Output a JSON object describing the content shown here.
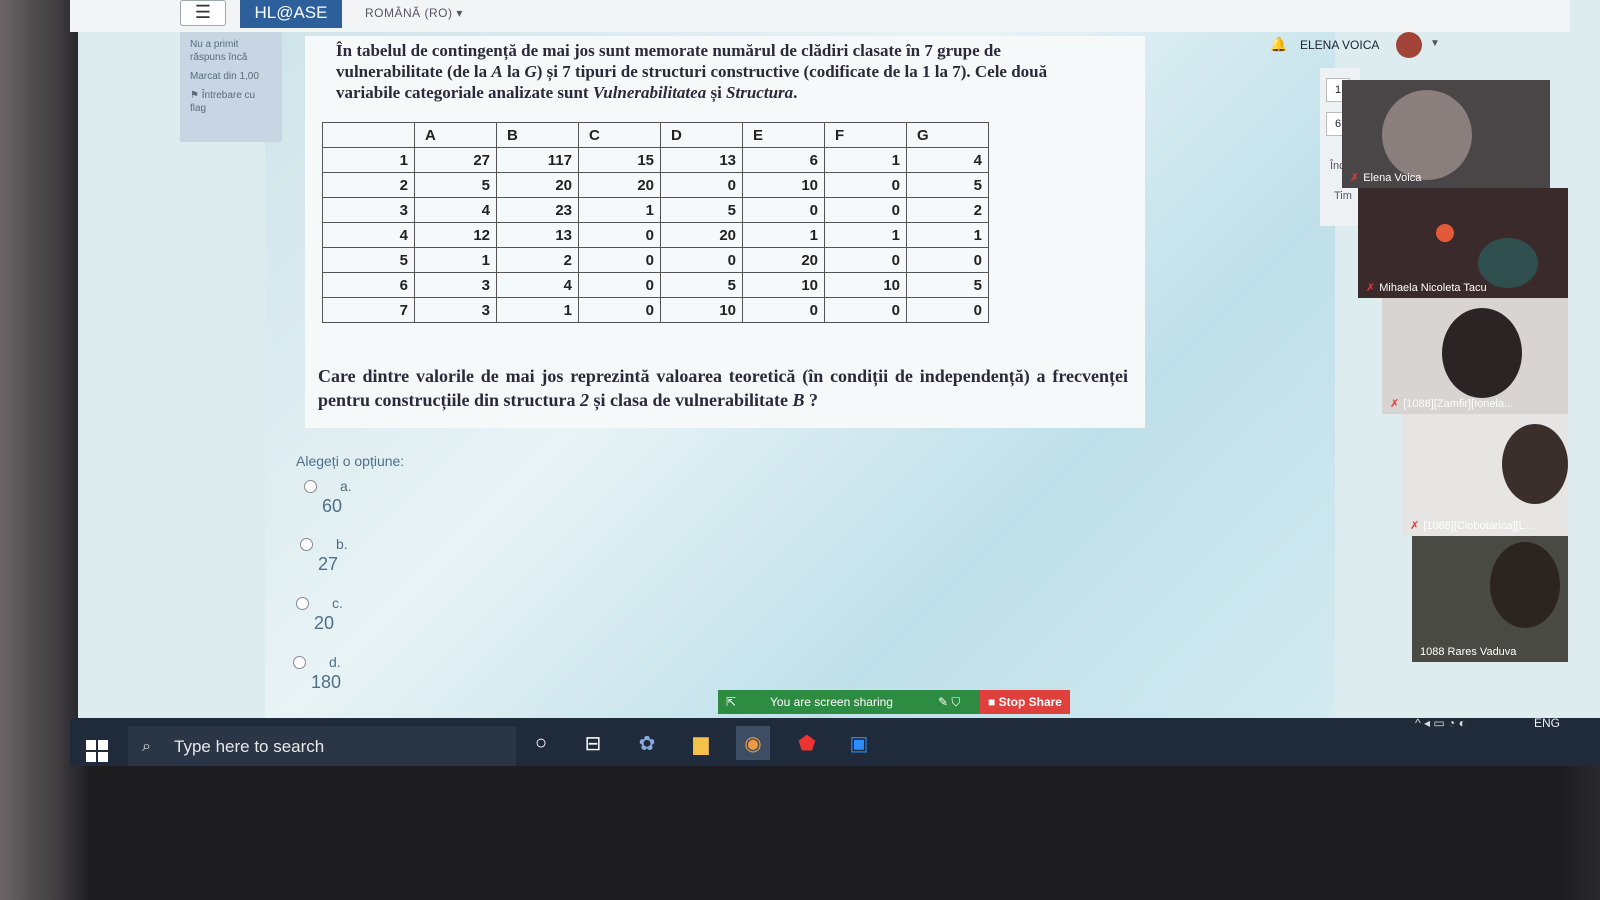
{
  "nav": {
    "menu_icon": "☰",
    "brand": "HL@ASE",
    "language": "ROMÂNĂ (RO) ▾",
    "user_name": "ELENA VOICA"
  },
  "question_info": {
    "status": "Nu a primit răspuns încă",
    "marked": "Marcat din 1,00",
    "flag": "Întrebare cu flag"
  },
  "question": {
    "text_part1": "În tabelul de contingență de mai jos sunt memorate numărul de clădiri clasate în 7 grupe de vulnerabilitate (de la ",
    "text_A": "A",
    "text_part2": " la ",
    "text_G": "G",
    "text_part3": ") și 7 tipuri de structuri constructive (codificate de la 1 la 7). Cele două variabile categoriale analizate sunt ",
    "text_var1": "Vulnerabilitatea",
    "text_part4": " și ",
    "text_var2": "Structura",
    "text_part5": ".",
    "columns": [
      "A",
      "B",
      "C",
      "D",
      "E",
      "F",
      "G"
    ],
    "rows": [
      {
        "label": "1",
        "values": [
          "27",
          "117",
          "15",
          "13",
          "6",
          "1",
          "4"
        ]
      },
      {
        "label": "2",
        "values": [
          "5",
          "20",
          "20",
          "0",
          "10",
          "0",
          "5"
        ]
      },
      {
        "label": "3",
        "values": [
          "4",
          "23",
          "1",
          "5",
          "0",
          "0",
          "2"
        ]
      },
      {
        "label": "4",
        "values": [
          "12",
          "13",
          "0",
          "20",
          "1",
          "1",
          "1"
        ]
      },
      {
        "label": "5",
        "values": [
          "1",
          "2",
          "0",
          "0",
          "20",
          "0",
          "0"
        ]
      },
      {
        "label": "6",
        "values": [
          "3",
          "4",
          "0",
          "5",
          "10",
          "10",
          "5"
        ]
      },
      {
        "label": "7",
        "values": [
          "3",
          "1",
          "0",
          "10",
          "0",
          "0",
          "0"
        ]
      }
    ],
    "prompt_part1": "Care dintre valorile de mai jos reprezintă valoarea teoretică (în condiții de independență) a frecvenței pentru construcțiile din structura ",
    "prompt_2": "2",
    "prompt_part2": " și clasa de vulnerabilitate ",
    "prompt_B": "B",
    "prompt_part3": " ?"
  },
  "options": {
    "title": "Alegeți o opțiune:",
    "items": [
      {
        "letter": "a.",
        "value": "60"
      },
      {
        "letter": "b.",
        "value": "27"
      },
      {
        "letter": "c.",
        "value": "20"
      },
      {
        "letter": "d.",
        "value": "180"
      }
    ]
  },
  "sidepanel": {
    "num1": "1",
    "num2": "6",
    "inch": "Înch",
    "tim": "Tim"
  },
  "participants": [
    {
      "name": "Elena Voica"
    },
    {
      "name": "Mihaela Nicoleta Tacu"
    },
    {
      "name": "[1088][Zamfir][Ionela..."
    },
    {
      "name": "[1088][Ciobotarica][L..."
    },
    {
      "name": "1088 Rares Vaduva"
    }
  ],
  "share": {
    "status": "You are screen sharing",
    "stop": "Stop Share"
  },
  "taskbar": {
    "search_placeholder": "Type here to search",
    "language": "ENG"
  },
  "colors": {
    "brand": "#2d5f9a",
    "share_green": "#2e8b42",
    "stop_red": "#e0403c",
    "taskbar": "#1f2a3a"
  }
}
